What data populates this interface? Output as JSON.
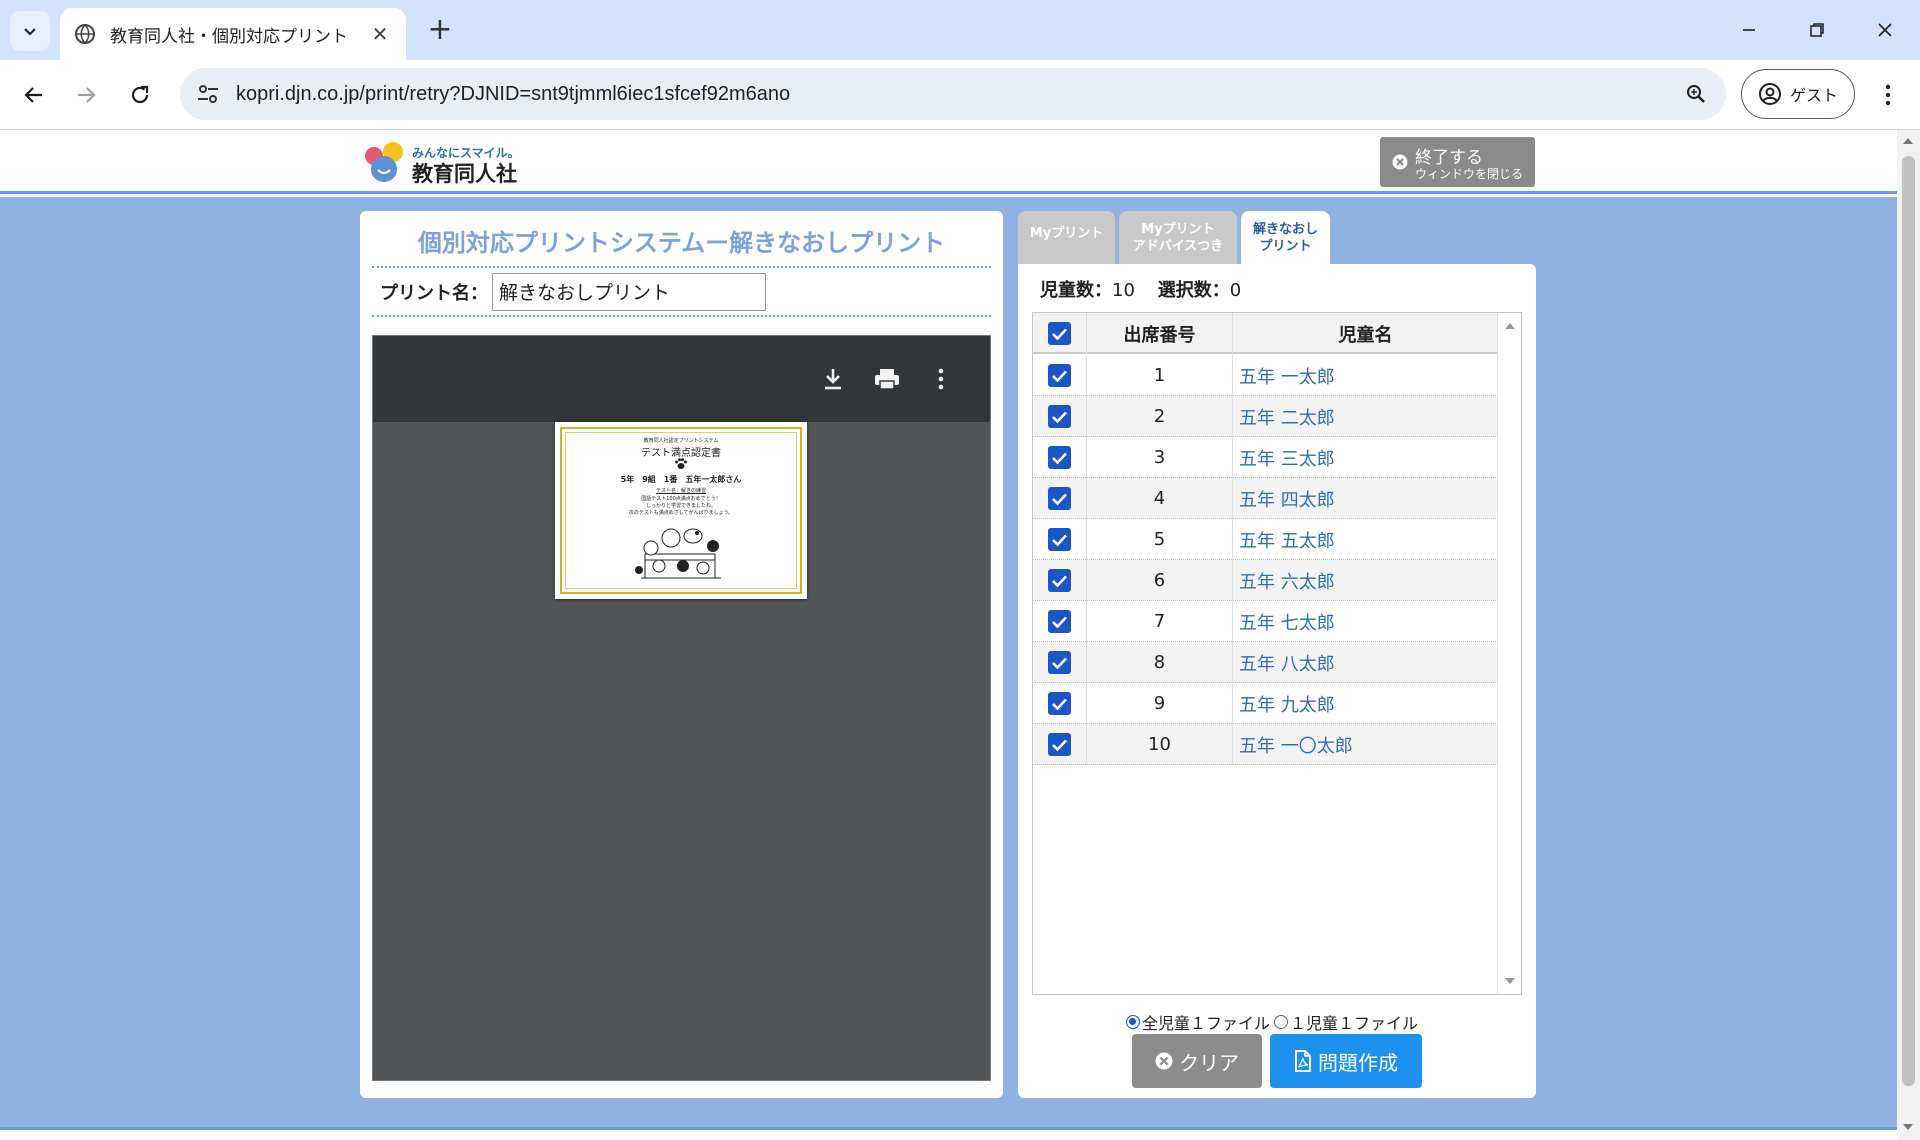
{
  "browser": {
    "tab_title": "教育同人社・個別対応プリント",
    "new_tab_label": "+",
    "url": "kopri.djn.co.jp/print/retry?DJNID=snt9tjmml6iec1sfcef92m6ano",
    "profile_label": "ゲスト"
  },
  "header": {
    "logo_tagline": "みんなにスマイル。",
    "logo_brand": "教育同人社",
    "exit_main": "終了する",
    "exit_sub": "ウィンドウを閉じる"
  },
  "left_panel": {
    "title": "個別対応プリントシステムー解きなおしプリント",
    "print_name_label": "プリント名：",
    "print_name_value": "解きなおしプリント"
  },
  "certificate": {
    "top_line": "教育同人社認定プリントシステム",
    "title": "テスト満点認定書",
    "student_line": "5年　9組　1番　五年一太郎さん",
    "subtitle": "テスト名：解きの練習",
    "message1": "国語テスト100点満点おめでとう！",
    "message2": "しっかりと学習できましたね。",
    "message3": "次のテストも満点めざしてがんばりましょう。"
  },
  "tabs": [
    {
      "label_line1": "Myプリント",
      "label_line2": ""
    },
    {
      "label_line1": "Myプリント",
      "label_line2": "アドバイスつき"
    },
    {
      "label_line1": "解きなおし",
      "label_line2": "プリント"
    }
  ],
  "counts": {
    "students_label": "児童数：",
    "students_value": "10",
    "selected_label": "選択数：",
    "selected_value": "0"
  },
  "table": {
    "header_number": "出席番号",
    "header_name": "児童名",
    "rows": [
      {
        "number": "1",
        "name": "五年 一太郎"
      },
      {
        "number": "2",
        "name": "五年 二太郎"
      },
      {
        "number": "3",
        "name": "五年 三太郎"
      },
      {
        "number": "4",
        "name": "五年 四太郎"
      },
      {
        "number": "5",
        "name": "五年 五太郎"
      },
      {
        "number": "6",
        "name": "五年 六太郎"
      },
      {
        "number": "7",
        "name": "五年 七太郎"
      },
      {
        "number": "8",
        "name": "五年 八太郎"
      },
      {
        "number": "9",
        "name": "五年 九太郎"
      },
      {
        "number": "10",
        "name": "五年 一〇太郎"
      }
    ]
  },
  "output_options": {
    "option_all": "全児童１ファイル",
    "option_each": "１児童１ファイル"
  },
  "buttons": {
    "clear": "クリア",
    "create": "問題作成"
  },
  "colors": {
    "page_background": "#8fb2e2",
    "accent_blue": "#1a56c8",
    "create_button": "#1e90f0",
    "name_link": "#2d6fb5"
  }
}
